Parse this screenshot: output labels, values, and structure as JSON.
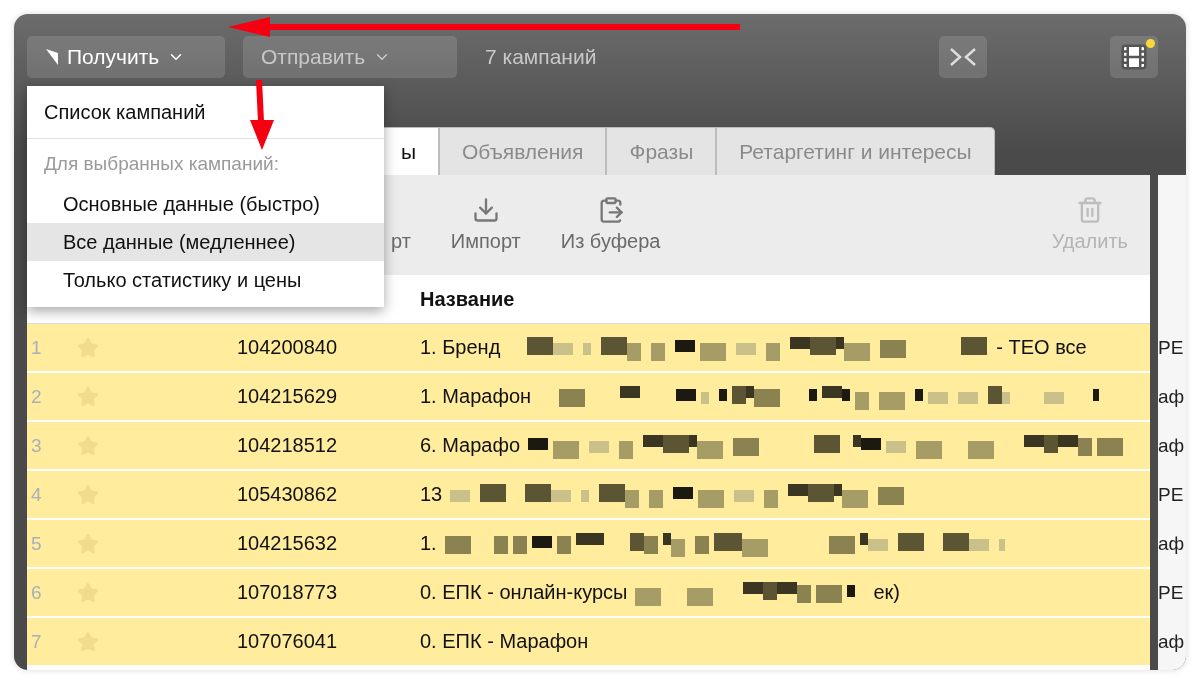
{
  "toolbar": {
    "buttons": [
      {
        "label": "Получить",
        "kind": "receive"
      },
      {
        "label": "Отправить",
        "kind": "send"
      }
    ],
    "campaign_count": "7 кампаний"
  },
  "menu": {
    "items": [
      {
        "kind": "item",
        "label": "Список кампаний",
        "selected": false
      },
      {
        "kind": "header",
        "label": "Для выбранных кампаний:"
      },
      {
        "kind": "subitem",
        "label": "Основные данные (быстро)",
        "selected": false
      },
      {
        "kind": "subitem",
        "label": "Все данные (медленнее)",
        "selected": true
      },
      {
        "kind": "subitem",
        "label": "Только статистику и цены",
        "selected": false
      }
    ]
  },
  "tabs": [
    {
      "label": "ы",
      "selected": true
    },
    {
      "label": "Объявления",
      "selected": false
    },
    {
      "label": "Фразы",
      "selected": false
    },
    {
      "label": "Ретаргетинг и интересы",
      "selected": false
    }
  ],
  "actions": [
    {
      "label": "рт",
      "kind": "export",
      "disabled": false
    },
    {
      "label": "Импорт",
      "kind": "import",
      "disabled": false
    },
    {
      "label": "Из буфера",
      "kind": "paste",
      "disabled": false
    },
    {
      "label": "Удалить",
      "kind": "delete",
      "disabled": true
    }
  ],
  "table": {
    "columns": [
      "Название"
    ],
    "rows": [
      {
        "number": "1",
        "starred": false,
        "id": "104200840",
        "name": "1. Бренд",
        "tail": "- ТЕО все"
      },
      {
        "number": "2",
        "starred": false,
        "id": "104215629",
        "name": "1. Марафон"
      },
      {
        "number": "3",
        "starred": false,
        "id": "104218512",
        "name": "6. Марафо"
      },
      {
        "number": "4",
        "starred": false,
        "id": "105430862",
        "name": "13"
      },
      {
        "number": "5",
        "starred": false,
        "id": "104215632",
        "name": "1."
      },
      {
        "number": "6",
        "starred": false,
        "id": "107018773",
        "name": "0. ЕПК - онлайн-курсы",
        "tail": "ек)"
      },
      {
        "number": "7",
        "starred": false,
        "id": "107076041",
        "name": "0. ЕПК - Марафон"
      }
    ]
  },
  "side_panel": {
    "rows": [
      "РЕ",
      "аф",
      "аф",
      "РЕ",
      "аф",
      "РЕ",
      "аф"
    ]
  }
}
